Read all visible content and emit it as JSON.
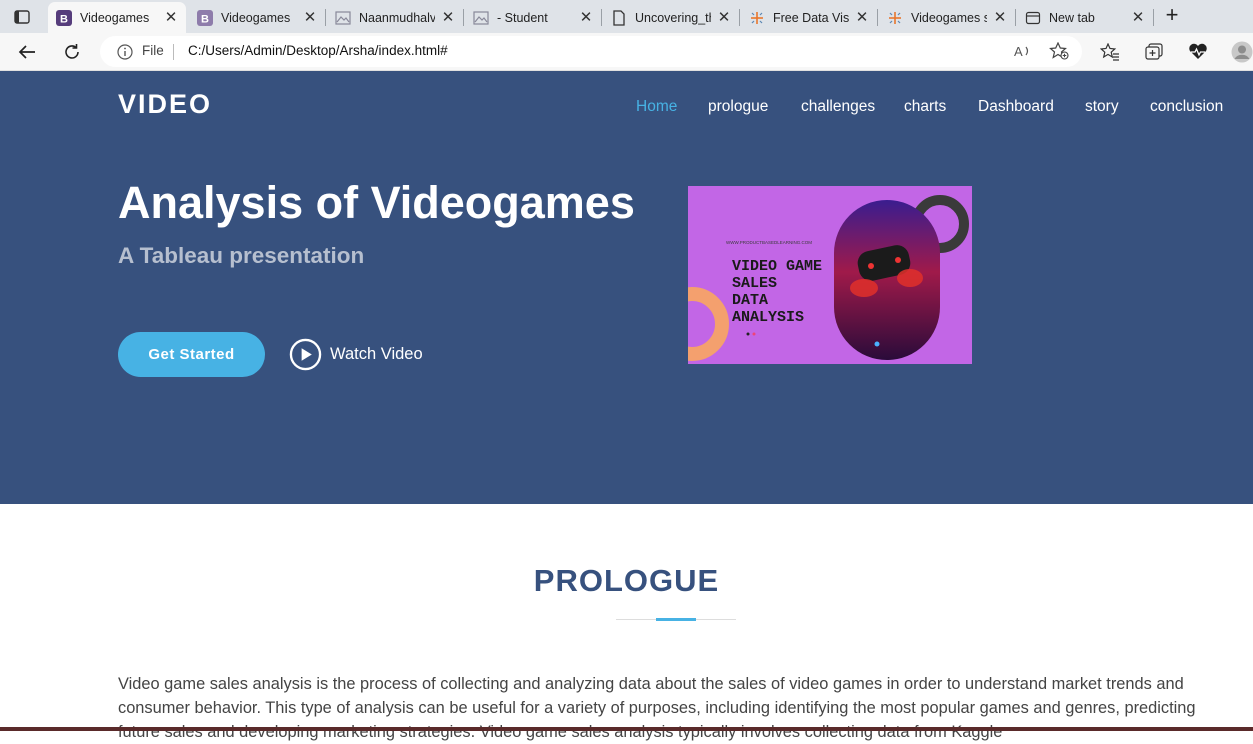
{
  "browser": {
    "tabs": [
      {
        "title": "Videogames",
        "icon": "bootstrap-b-icon",
        "active": true
      },
      {
        "title": "Videogames",
        "icon": "bootstrap-b-icon",
        "active": false
      },
      {
        "title": "Naanmudhalv",
        "icon": "broken-image-icon",
        "active": false
      },
      {
        "title": "- Student",
        "icon": "broken-image-icon",
        "active": false
      },
      {
        "title": "Uncovering_th",
        "icon": "document-icon",
        "active": false
      },
      {
        "title": "Free Data Visu",
        "icon": "tableau-icon",
        "active": false
      },
      {
        "title": "Videogames s",
        "icon": "tableau-icon",
        "active": false
      },
      {
        "title": "New tab",
        "icon": "newtab-icon",
        "active": false
      }
    ],
    "address": {
      "scheme_label": "File",
      "url": "C:/Users/Admin/Desktop/Arsha/index.html#"
    }
  },
  "site": {
    "logo": "VIDEO",
    "nav": [
      "Home",
      "prologue",
      "challenges",
      "charts",
      "Dashboard",
      "story",
      "conclusion"
    ],
    "hero": {
      "title": "Analysis of Videogames",
      "subtitle": "A Tableau presentation",
      "cta_label": "Get Started",
      "video_label": "Watch Video",
      "image": {
        "url_text": "WWW.PRODUCTBASEDLEARNING.COM",
        "lines": [
          "VIDEO GAME",
          "SALES",
          "DATA",
          "ANALYSIS"
        ]
      }
    },
    "prologue": {
      "heading": "PROLOGUE",
      "text": "Video game sales analysis is the process of collecting and analyzing data about the sales of video games in order to understand market trends and consumer behavior. This type of analysis can be useful for a variety of purposes, including identifying the most popular games and genres, predicting future sales and developing marketing strategies. Video game sales analysis typically involves collecting data from Kaggle"
    }
  },
  "colors": {
    "hero_bg": "#37517e",
    "accent": "#47b2e4",
    "heading": "#37517e"
  }
}
